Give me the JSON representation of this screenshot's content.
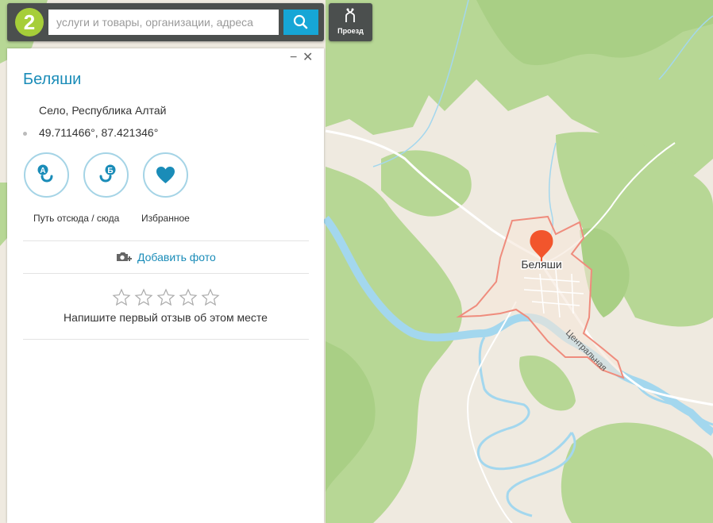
{
  "search": {
    "placeholder": "услуги и товары, организации, адреса"
  },
  "route_button": {
    "label": "Проезд"
  },
  "place": {
    "title": "Беляши",
    "type": "Село, Республика Алтай",
    "coordinates": "49.711466°, 87.421346°"
  },
  "actions": {
    "route_label": "Путь отсюда / сюда",
    "favorite_label": "Избранное",
    "add_photo": "Добавить фото"
  },
  "rating": {
    "stars": 5,
    "prompt": "Напишите первый отзыв об этом месте"
  },
  "map": {
    "marker_label": "Беляши",
    "street_label": "Центральная"
  },
  "colors": {
    "accent": "#1a8cb8",
    "search_button": "#16a6d6",
    "toolbar": "#4b4f4e",
    "forest": "#b7d795",
    "land": "#efeae0",
    "water": "#a3d7ee",
    "boundary": "#ef8c7d",
    "marker": "#f2552c"
  }
}
